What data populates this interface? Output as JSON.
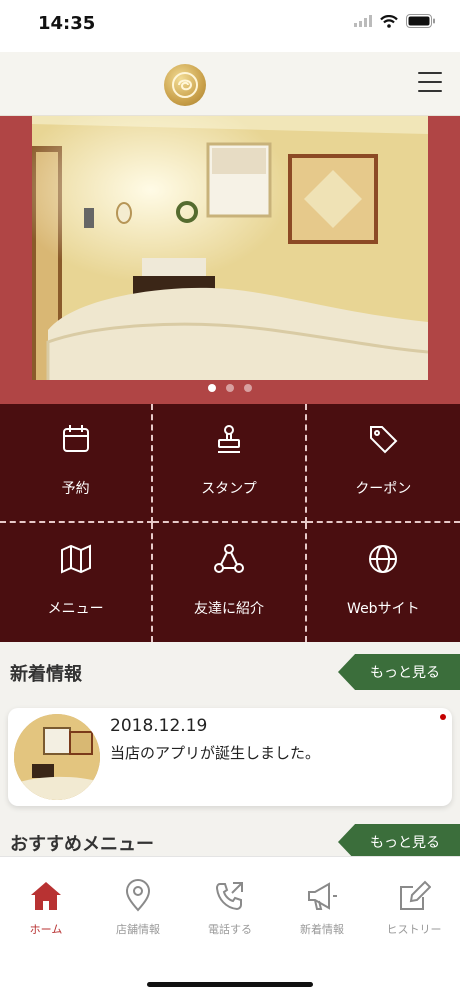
{
  "status_bar": {
    "time": "14:35"
  },
  "hero": {
    "slides": 3,
    "active_slide": 1
  },
  "grid": {
    "items": [
      {
        "label": "予約",
        "icon": "calendar-icon"
      },
      {
        "label": "スタンプ",
        "icon": "stamp-icon"
      },
      {
        "label": "クーポン",
        "icon": "tag-icon"
      },
      {
        "label": "メニュー",
        "icon": "map-icon"
      },
      {
        "label": "友達に紹介",
        "icon": "share-icon"
      },
      {
        "label": "Webサイト",
        "icon": "globe-icon"
      }
    ]
  },
  "news": {
    "title": "新着情報",
    "more": "もっと見る",
    "items": [
      {
        "date": "2018.12.19",
        "text": "当店のアプリが誕生しました。"
      }
    ]
  },
  "recommend": {
    "title": "おすすめメニュー",
    "more": "もっと見る"
  },
  "tabbar": {
    "items": [
      {
        "label": "ホーム",
        "icon": "home-icon"
      },
      {
        "label": "店舗情報",
        "icon": "location-pin-icon"
      },
      {
        "label": "電話する",
        "icon": "phone-icon"
      },
      {
        "label": "新着情報",
        "icon": "megaphone-icon"
      },
      {
        "label": "ヒストリー",
        "icon": "edit-icon"
      }
    ]
  },
  "colors": {
    "hero_frame": "#b04545",
    "grid_bg": "#4a0e10",
    "more_button": "#3b6e3b",
    "active_tab": "#b83232"
  }
}
